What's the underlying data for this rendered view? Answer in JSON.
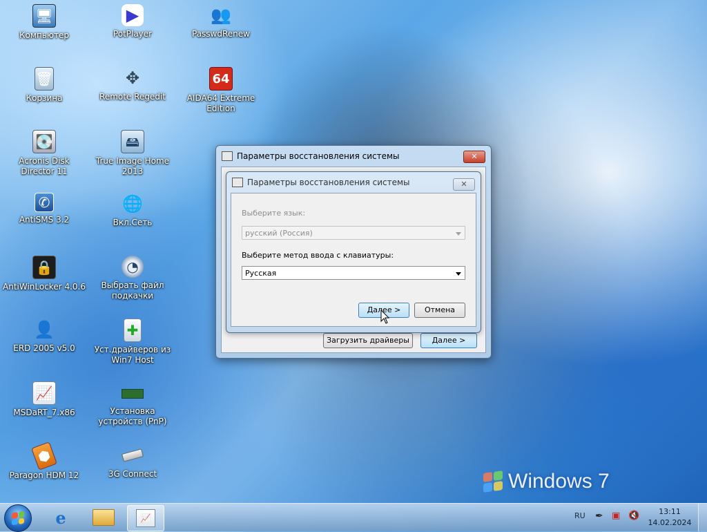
{
  "desktop": {
    "icons": [
      {
        "label": "Компьютер",
        "icon": "computer-icon"
      },
      {
        "label": "PotPlayer",
        "icon": "potplayer-icon"
      },
      {
        "label": "PasswdRenew",
        "icon": "users-icon"
      },
      {
        "label": "Корзина",
        "icon": "recycle-bin-icon"
      },
      {
        "label": "Remote Regedit",
        "icon": "regedit-icon"
      },
      {
        "label": "AIDA64 Extreme Edition",
        "icon": "aida64-icon",
        "badge": "64"
      },
      {
        "label": "Acronis Disk Director 11",
        "icon": "acronis-icon"
      },
      {
        "label": "True Image Home 2013",
        "icon": "true-image-icon"
      },
      {
        "label": "AntiSMS 3.2",
        "icon": "phone-icon"
      },
      {
        "label": "Вкл.Сеть",
        "icon": "network-icon"
      },
      {
        "label": "AntiWinLocker 4.0.6",
        "icon": "lock-icon"
      },
      {
        "label": "Выбрать файл подкачки",
        "icon": "disk-pie-icon"
      },
      {
        "label": "ERD 2005 v5.0",
        "icon": "erd-icon"
      },
      {
        "label": "Уст.драйверов из Win7 Host",
        "icon": "driver-install-icon"
      },
      {
        "label": "MSDaRT_7.x86",
        "icon": "msdart-icon"
      },
      {
        "label": "Установка устройств (PnP)",
        "icon": "ram-icon"
      },
      {
        "label": "Paragon HDM 12",
        "icon": "paragon-icon"
      },
      {
        "label": "3G Connect",
        "icon": "usb-modem-icon"
      }
    ],
    "watermark": "Windows 7"
  },
  "outer_dialog": {
    "title": "Параметры восстановления системы",
    "load_drivers_label": "Загрузить драйверы",
    "next_label": "Далее >"
  },
  "inner_dialog": {
    "title": "Параметры восстановления системы",
    "language_label": "Выберите язык:",
    "language_value": "русский (Россия)",
    "keyboard_label": "Выберите метод ввода с клавиатуры:",
    "keyboard_value": "Русская",
    "next_label": "Далее >",
    "cancel_label": "Отмена"
  },
  "taskbar": {
    "language": "RU",
    "time": "13:11",
    "date": "14.02.2024"
  },
  "colors": {
    "accent": "#3c7fb1",
    "close_red": "#c7412b"
  }
}
